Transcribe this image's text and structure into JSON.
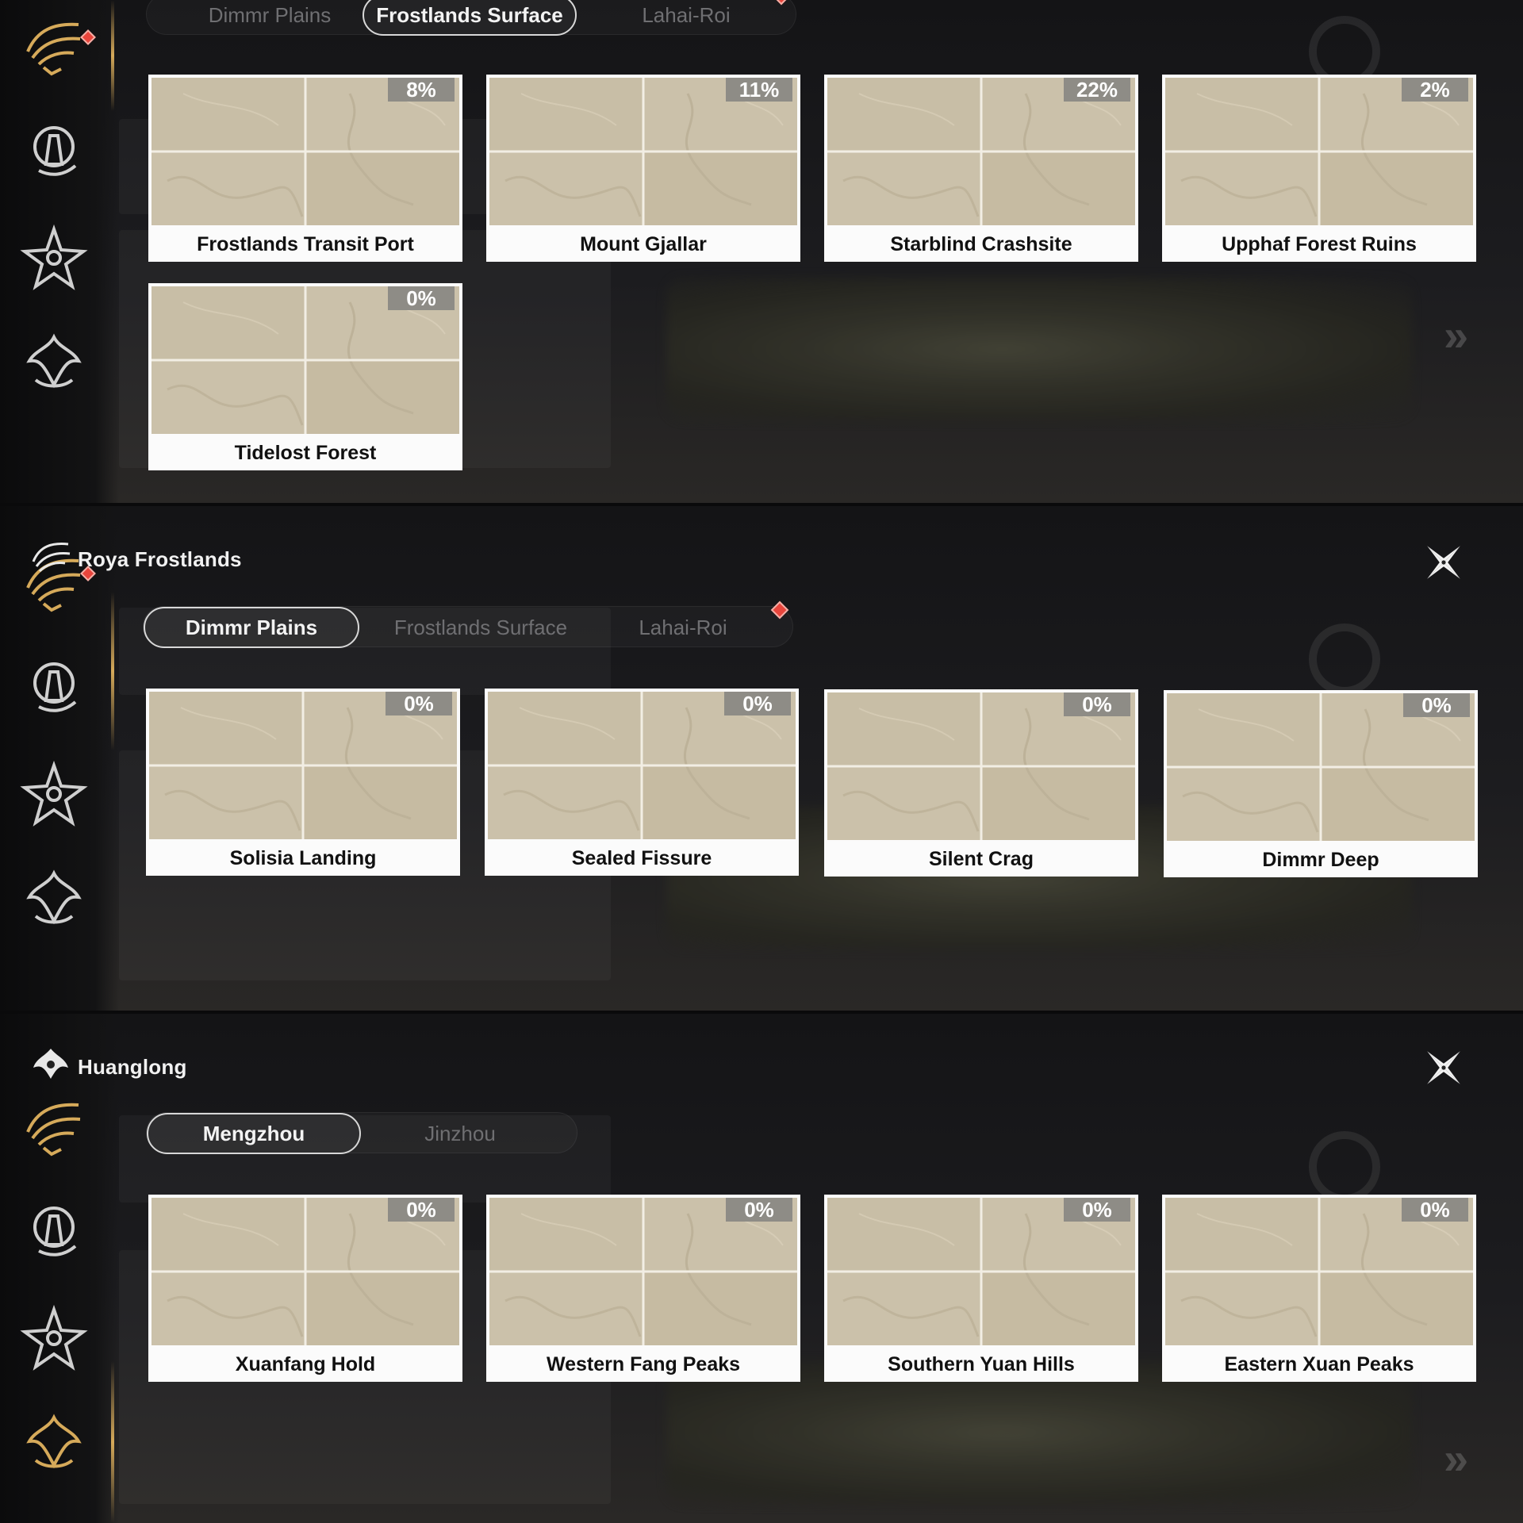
{
  "panels": [
    {
      "header": {
        "title": "",
        "icon": "eagle-crest-icon"
      },
      "tabs": [
        {
          "label": "Dimmr Plains",
          "active": false
        },
        {
          "label": "Frostlands Surface",
          "active": true
        },
        {
          "label": "Lahai-Roi",
          "active": false,
          "has_notification": true
        }
      ],
      "cards": [
        {
          "name": "Frostlands Transit Port",
          "progress": "8%"
        },
        {
          "name": "Mount Gjallar",
          "progress": "11%"
        },
        {
          "name": "Starblind Crashsite",
          "progress": "22%"
        },
        {
          "name": "Upphaf Forest Ruins",
          "progress": "2%"
        },
        {
          "name": "Tidelost Forest",
          "progress": "0%"
        }
      ]
    },
    {
      "header": {
        "title": "Roya Frostlands",
        "icon": "eagle-crest-icon"
      },
      "tabs": [
        {
          "label": "Dimmr Plains",
          "active": true
        },
        {
          "label": "Frostlands Surface",
          "active": false
        },
        {
          "label": "Lahai-Roi",
          "active": false,
          "has_notification": true
        }
      ],
      "cards": [
        {
          "name": "Solisia Landing",
          "progress": "0%"
        },
        {
          "name": "Sealed Fissure",
          "progress": "0%"
        },
        {
          "name": "Silent Crag",
          "progress": "0%"
        },
        {
          "name": "Dimmr Deep",
          "progress": "0%"
        }
      ]
    },
    {
      "header": {
        "title": "Huanglong",
        "icon": "dragon-crest-icon"
      },
      "tabs": [
        {
          "label": "Mengzhou",
          "active": true
        },
        {
          "label": "Jinzhou",
          "active": false
        }
      ],
      "cards": [
        {
          "name": "Xuanfang Hold",
          "progress": "0%"
        },
        {
          "name": "Western Fang Peaks",
          "progress": "0%"
        },
        {
          "name": "Southern Yuan Hills",
          "progress": "0%"
        },
        {
          "name": "Eastern Xuan Peaks",
          "progress": "0%"
        }
      ]
    }
  ],
  "sidebar_icons": [
    "eagle-emblem-icon",
    "tower-emblem-icon",
    "star-emblem-icon",
    "dragon-emblem-icon"
  ],
  "colors": {
    "accent_gold": "#d6aa5a",
    "notification_red": "#e8453c",
    "card_map": "#c9bfa7",
    "badge_bg": "#8e8c86"
  }
}
